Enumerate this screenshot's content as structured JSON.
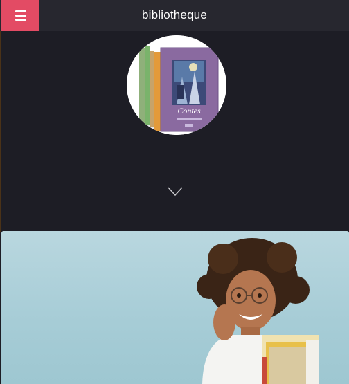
{
  "header": {
    "title": "bibliotheque",
    "menu_icon": "hamburger-icon",
    "menu_color": "#e34b64",
    "background": "#27272f"
  },
  "profile": {
    "book_title": "Contes",
    "book_colors": [
      "#8a6aa0",
      "#e39a3a",
      "#7ab36b",
      "#8fb07a"
    ]
  },
  "scroll_indicator": {
    "icon": "chevron-down-icon"
  },
  "colors": {
    "page_background": "#1d1d25",
    "hero_background": "#b2d4dd"
  }
}
